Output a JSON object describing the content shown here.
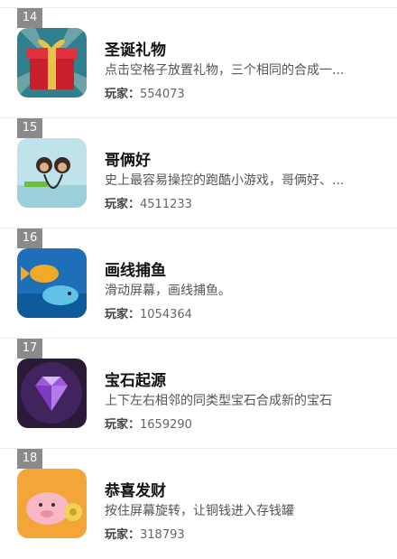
{
  "items": [
    {
      "rank": "14",
      "title": "圣诞礼物",
      "desc": "点击空格子放置礼物，三个相同的合成一...",
      "players_label": "玩家：",
      "players": "554073",
      "icon": "gift-box-icon"
    },
    {
      "rank": "15",
      "title": "哥俩好",
      "desc": "史上最容易操控的跑酷小游戏，哥俩好、...",
      "players_label": "玩家：",
      "players": "4511233",
      "icon": "two-monkeys-icon"
    },
    {
      "rank": "16",
      "title": "画线捕鱼",
      "desc": "滑动屏幕，画线捕鱼。",
      "players_label": "玩家：",
      "players": "1054364",
      "icon": "fish-icon"
    },
    {
      "rank": "17",
      "title": "宝石起源",
      "desc": "上下左右相邻的同类型宝石合成新的宝石",
      "players_label": "玩家：",
      "players": "1659290",
      "icon": "gem-icon"
    },
    {
      "rank": "18",
      "title": "恭喜发财",
      "desc": "按住屏幕旋转，让铜钱进入存钱罐",
      "players_label": "玩家：",
      "players": "318793",
      "icon": "piggy-bank-icon"
    }
  ]
}
